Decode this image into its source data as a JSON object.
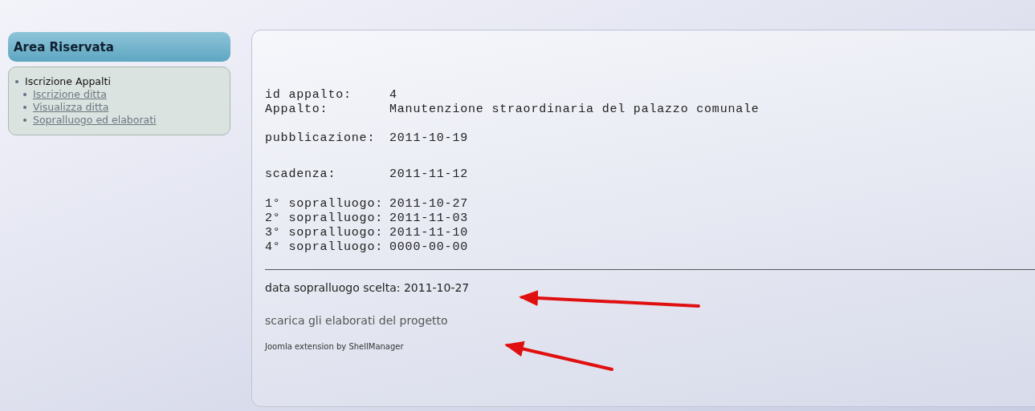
{
  "sidebar": {
    "title": "Area Riservata",
    "menu": [
      {
        "label": "Iscrizione Appalti",
        "children": [
          {
            "label": "Iscrizione ditta"
          },
          {
            "label": "Visualizza ditta"
          },
          {
            "label": "Sopralluogo ed elaborati"
          }
        ]
      }
    ]
  },
  "details": {
    "groups": [
      [
        {
          "label": "id appalto:",
          "value": "4"
        },
        {
          "label": "Appalto:",
          "value": "Manutenzione straordinaria del palazzo comunale"
        }
      ],
      [
        {
          "label": "pubblicazione:",
          "value": "2011-10-19"
        }
      ],
      [
        {
          "label": "scadenza:",
          "value": "2011-11-12"
        }
      ],
      [
        {
          "label": "1° sopralluogo:",
          "value": "2011-10-27"
        },
        {
          "label": "2° sopralluogo:",
          "value": "2011-11-03"
        },
        {
          "label": "3° sopralluogo:",
          "value": "2011-11-10"
        },
        {
          "label": "4° sopralluogo:",
          "value": "0000-00-00"
        }
      ]
    ]
  },
  "chosen_date": "data sopralluogo scelta: 2011-10-27",
  "download_link": "scarica gli elaborati del progetto",
  "footer": "Joomla extension by ShellManager"
}
